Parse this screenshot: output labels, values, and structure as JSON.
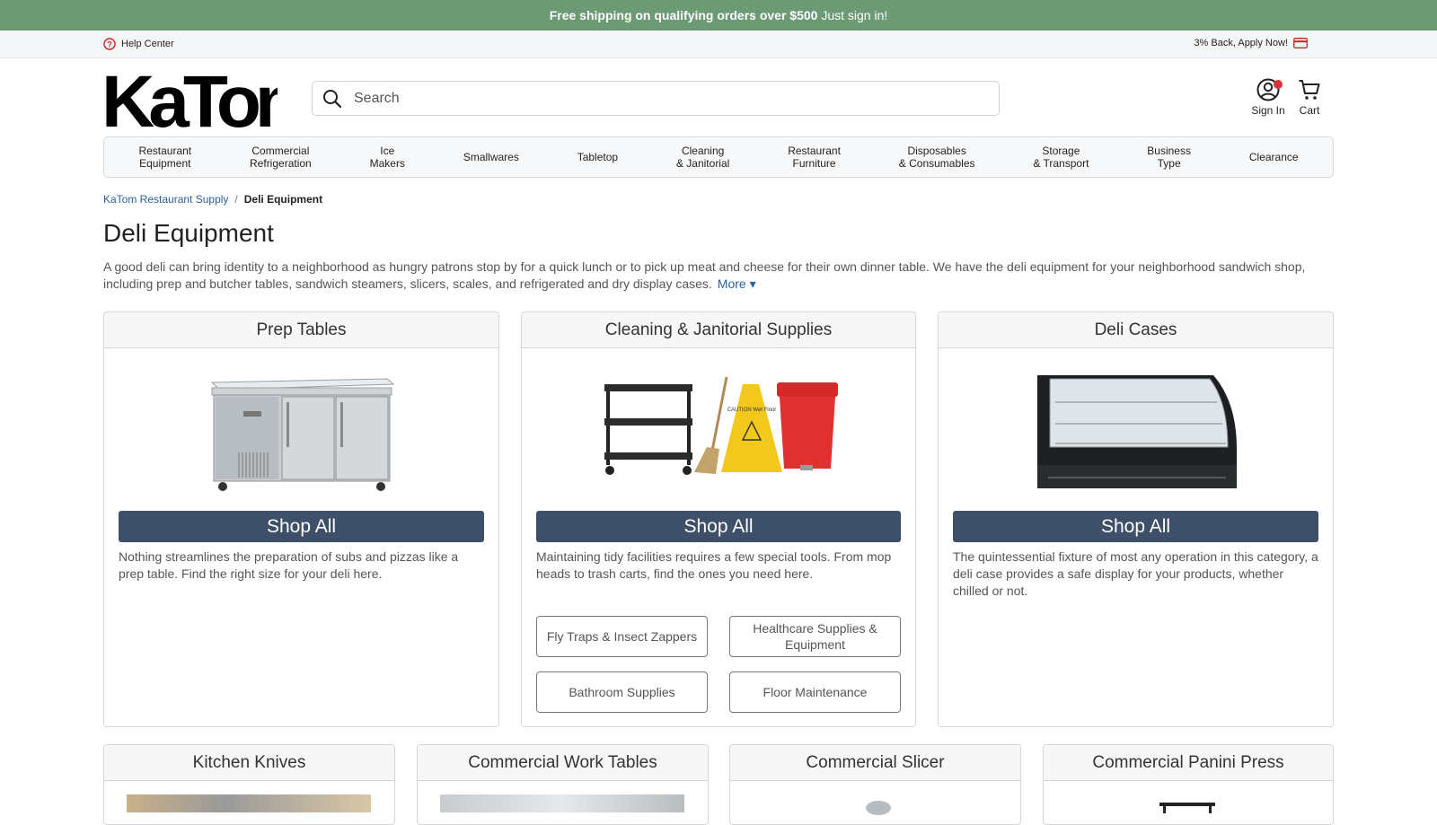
{
  "promo": {
    "bold": "Free shipping on qualifying orders over $500",
    "rest": " Just sign in!"
  },
  "utility": {
    "help_label": "Help Center",
    "back_label": "3% Back, Apply Now!"
  },
  "header": {
    "logo_text": "KaTom",
    "search_placeholder": "Search",
    "sign_in_label": "Sign In",
    "cart_label": "Cart"
  },
  "nav": {
    "items": [
      {
        "l1": "Restaurant",
        "l2": "Equipment"
      },
      {
        "l1": "Commercial",
        "l2": "Refrigeration"
      },
      {
        "l1": "Ice",
        "l2": "Makers"
      },
      {
        "l1": "Smallwares",
        "l2": ""
      },
      {
        "l1": "Tabletop",
        "l2": ""
      },
      {
        "l1": "Cleaning",
        "l2": "& Janitorial"
      },
      {
        "l1": "Restaurant",
        "l2": "Furniture"
      },
      {
        "l1": "Disposables",
        "l2": "& Consumables"
      },
      {
        "l1": "Storage",
        "l2": "& Transport"
      },
      {
        "l1": "Business",
        "l2": "Type"
      },
      {
        "l1": "Clearance",
        "l2": ""
      }
    ]
  },
  "breadcrumb": {
    "home": "KaTom Restaurant Supply",
    "separator": "/",
    "current": "Deli Equipment"
  },
  "page": {
    "title": "Deli Equipment",
    "intro": "A good deli can bring identity to a neighborhood as hungry patrons stop by for a quick lunch or to pick up meat and cheese for their own dinner table. We have the deli equipment for your neighborhood sandwich shop, including prep and butcher tables, sandwich steamers, slicers, scales, and refrigerated and dry display cases.",
    "more_label": "More ▾"
  },
  "cards": [
    {
      "title": "Prep Tables",
      "shop_label": "Shop All",
      "desc": "Nothing streamlines the preparation of subs and pizzas like a prep table. Find the right size for your deli here."
    },
    {
      "title": "Cleaning & Janitorial Supplies",
      "shop_label": "Shop All",
      "desc": "Maintaining tidy facilities requires a few special tools. From mop heads to trash carts, find the ones you need here.",
      "subs": [
        "Fly Traps & Insect Zappers",
        "Healthcare Supplies & Equipment",
        "Bathroom Supplies",
        "Floor Maintenance"
      ],
      "sign_text": "CAUTION Wet Floor"
    },
    {
      "title": "Deli Cases",
      "shop_label": "Shop All",
      "desc": "The quintessential fixture of most any operation in this category, a deli case provides a safe display for your products, whether chilled or not."
    }
  ],
  "cards_row2": [
    {
      "title": "Kitchen Knives"
    },
    {
      "title": "Commercial Work Tables"
    },
    {
      "title": "Commercial Slicer"
    },
    {
      "title": "Commercial Panini Press"
    }
  ],
  "colors": {
    "promo_bg": "#6b9a74",
    "shop_button": "#3e5069",
    "link": "#2c5f9e",
    "badge": "#d9343a"
  }
}
